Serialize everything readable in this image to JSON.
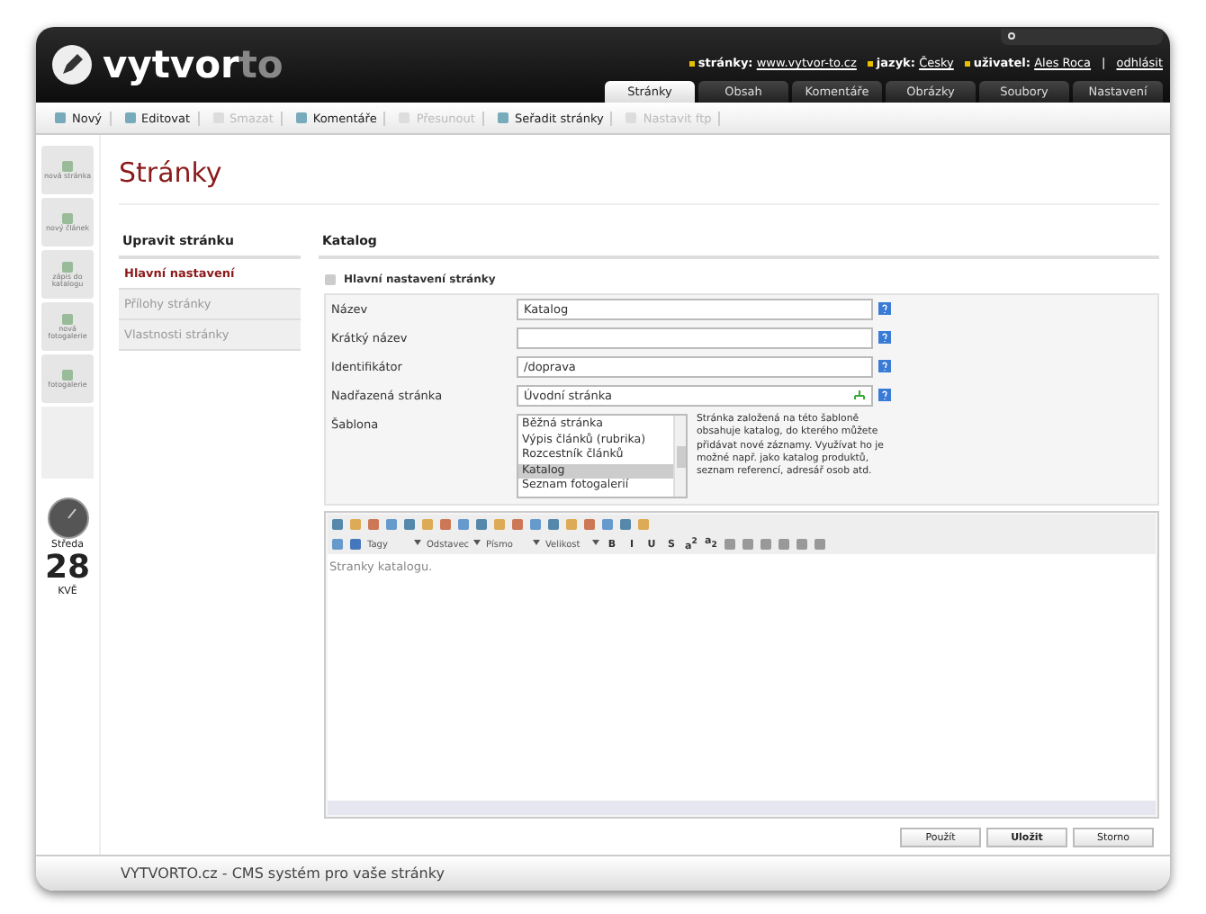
{
  "header": {
    "logo_main": "vytvor",
    "logo_accent": "to",
    "info": [
      {
        "label": "stránky:",
        "value": "www.vytvor-to.cz"
      },
      {
        "label": "jazyk:",
        "value": "Česky"
      },
      {
        "label": "uživatel:",
        "value": "Ales Roca"
      }
    ],
    "logout": "odhlásit",
    "separator": "|"
  },
  "tabs": [
    {
      "label": "Stránky",
      "selected": true
    },
    {
      "label": "Obsah",
      "selected": false
    },
    {
      "label": "Komentáře",
      "selected": false
    },
    {
      "label": "Obrázky",
      "selected": false
    },
    {
      "label": "Soubory",
      "selected": false
    },
    {
      "label": "Nastavení",
      "selected": false
    }
  ],
  "toolbar": [
    {
      "label": "Nový",
      "disabled": false
    },
    {
      "label": "Editovat",
      "disabled": false
    },
    {
      "label": "Smazat",
      "disabled": true
    },
    {
      "label": "Komentáře",
      "disabled": false
    },
    {
      "label": "Přesunout",
      "disabled": true
    },
    {
      "label": "Seřadit stránky",
      "disabled": false
    },
    {
      "label": "Nastavit ftp",
      "disabled": true
    }
  ],
  "quickbar": [
    {
      "label": "nová stránka"
    },
    {
      "label": "nový článek"
    },
    {
      "label": "zápis do katalogu"
    },
    {
      "label": "nová fotogalerie"
    },
    {
      "label": "fotogalerie"
    }
  ],
  "calendar": {
    "weekday": "Středa",
    "day": "28",
    "month": "KVĚ"
  },
  "page_title": "Stránky",
  "left_panel": {
    "title": "Upravit stránku",
    "items": [
      {
        "label": "Hlavní nastavení",
        "selected": true
      },
      {
        "label": "Přílohy stránky",
        "selected": false
      },
      {
        "label": "Vlastnosti stránky",
        "selected": false
      }
    ]
  },
  "content": {
    "title": "Katalog",
    "section": "Hlavní nastavení stránky",
    "fields": [
      {
        "kind": "text",
        "label": "Název",
        "value": "Katalog"
      },
      {
        "kind": "text",
        "label": "Krátký název"
      },
      {
        "kind": "text",
        "label": "Identifikátor",
        "value": "/doprava"
      },
      {
        "kind": "picker",
        "label": "Nadřazená stránka",
        "value": "Úvodní stránka"
      },
      {
        "kind": "list",
        "label": "Šablona",
        "options": [
          {
            "label": "Běžná stránka",
            "selected": false
          },
          {
            "label": "Výpis článků (rubrika)",
            "selected": false
          },
          {
            "label": "Rozcestník článků",
            "selected": false
          },
          {
            "label": "Katalog",
            "selected": true
          },
          {
            "label": "Seznam fotogalerií",
            "selected": false
          }
        ],
        "note": "Stránka založená na této šabloně obsahuje katalog, do kterého můžete přidávat nové záznamy. Využívat ho je možné např. jako katalog produktů, seznam referencí, adresář osob atd."
      }
    ]
  },
  "editor": {
    "dropdowns": [
      "Tagy",
      "Odstavec",
      "Písmo",
      "Velikost"
    ],
    "format_buttons": [
      "B",
      "I",
      "U",
      "S",
      "a$^{2}$",
      "a$_{2}$"
    ],
    "text": "Stranky katalogu."
  },
  "buttons": [
    {
      "label": "Použít",
      "primary": false
    },
    {
      "label": "Uložit",
      "primary": true
    },
    {
      "label": "Storno",
      "primary": false
    }
  ],
  "footer": "VYTVORTO.cz - CMS systém pro vaše stránky"
}
